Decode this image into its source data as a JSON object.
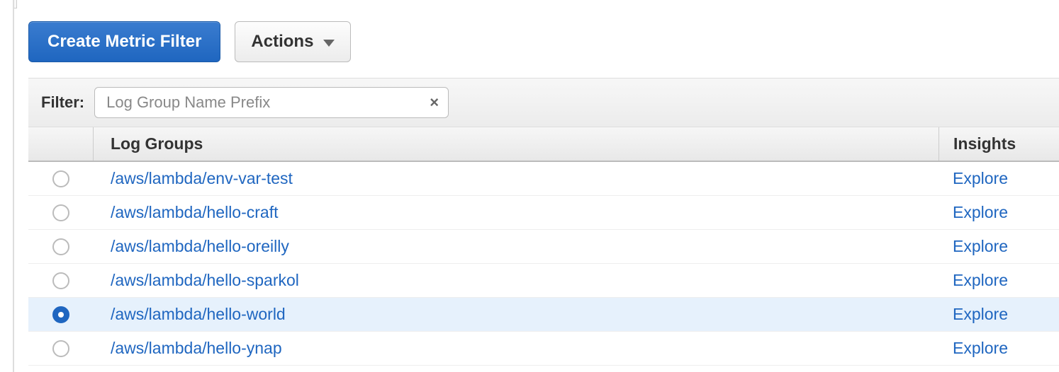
{
  "toolbar": {
    "create_button": "Create Metric Filter",
    "actions_button": "Actions"
  },
  "filter": {
    "label": "Filter:",
    "placeholder": "Log Group Name Prefix"
  },
  "table": {
    "header_name": "Log Groups",
    "header_insights": "Insights"
  },
  "rows": [
    {
      "name": "/aws/lambda/env-var-test",
      "insights": "Explore",
      "selected": false
    },
    {
      "name": "/aws/lambda/hello-craft",
      "insights": "Explore",
      "selected": false
    },
    {
      "name": "/aws/lambda/hello-oreilly",
      "insights": "Explore",
      "selected": false
    },
    {
      "name": "/aws/lambda/hello-sparkol",
      "insights": "Explore",
      "selected": false
    },
    {
      "name": "/aws/lambda/hello-world",
      "insights": "Explore",
      "selected": true
    },
    {
      "name": "/aws/lambda/hello-ynap",
      "insights": "Explore",
      "selected": false
    }
  ]
}
